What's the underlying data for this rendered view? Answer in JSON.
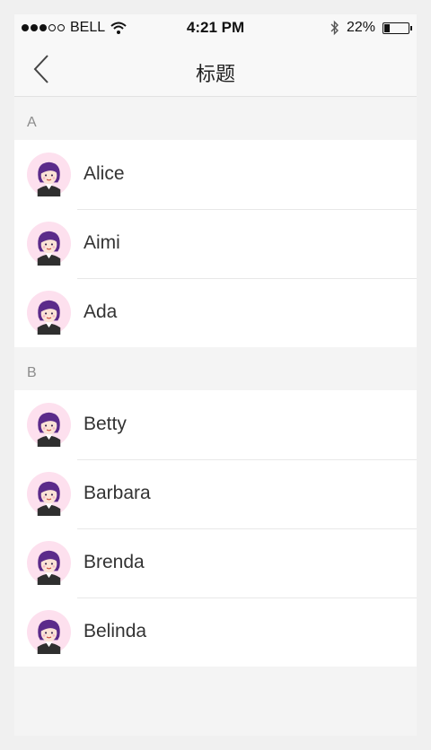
{
  "status": {
    "carrier": "BELL",
    "time": "4:21 PM",
    "battery_text": "22%",
    "battery_level": 0.22
  },
  "nav": {
    "title": "标题",
    "back_icon": "chevron-left-icon"
  },
  "sections": [
    {
      "header": "A",
      "contacts": [
        {
          "name": "Alice"
        },
        {
          "name": "Aimi"
        },
        {
          "name": "Ada"
        }
      ]
    },
    {
      "header": "B",
      "contacts": [
        {
          "name": "Betty"
        },
        {
          "name": "Barbara"
        },
        {
          "name": "Brenda"
        },
        {
          "name": "Belinda"
        }
      ]
    }
  ],
  "colors": {
    "avatar_bg": "#fde0ee",
    "avatar_hair": "#5b2b8a",
    "background": "#f4f4f4"
  }
}
